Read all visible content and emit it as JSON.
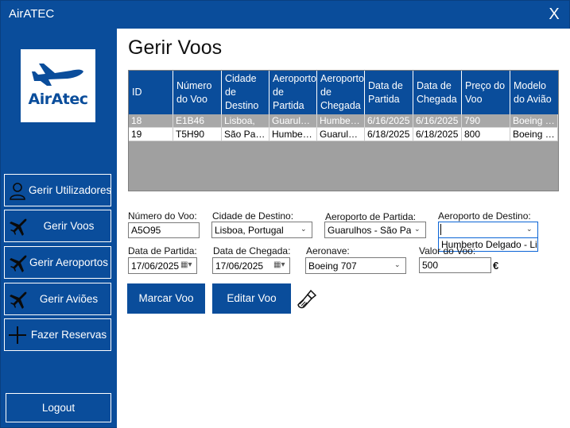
{
  "app": {
    "title": "AirATEC",
    "close_glyph": "X",
    "logo_text": "AirAtec"
  },
  "sidebar": {
    "items": [
      {
        "label": "Gerir Utilizadores",
        "icon": "user-icon"
      },
      {
        "label": "Gerir Voos",
        "icon": "airplane-icon"
      },
      {
        "label": "Gerir Aeroportos",
        "icon": "airplane-icon"
      },
      {
        "label": "Gerir Aviões",
        "icon": "airplane-icon"
      },
      {
        "label": "Fazer Reservas",
        "icon": "plus-icon"
      }
    ],
    "logout_label": "Logout"
  },
  "main": {
    "title": "Gerir Voos",
    "table": {
      "headers": [
        "ID",
        "Número do Voo",
        "Cidade de Destino",
        "Aeroporto de Partida",
        "Aeroporto de Chegada",
        "Data de Partida",
        "Data de Chegada",
        "Preço do Voo",
        "Modelo do Avião"
      ],
      "rows": [
        [
          "18",
          "E1B46",
          "Lisboa,",
          "Guarulhos",
          "Humbert...",
          "6/16/2025",
          "6/16/2025",
          "790",
          "Boeing 7..."
        ],
        [
          "19",
          "T5H90",
          "São Paul...",
          "Humbert...",
          "Guarulhos",
          "6/18/2025",
          "6/18/2025",
          "800",
          "Boeing 7..."
        ]
      ]
    },
    "form": {
      "numero_voo": {
        "label": "Número do Voo:",
        "value": "A5O95"
      },
      "cidade_destino": {
        "label": "Cidade de Destino:",
        "value": "Lisboa, Portugal"
      },
      "aeroporto_partida": {
        "label": "Aeroporto de Partida:",
        "value": "Guarulhos - São Paulo"
      },
      "aeroporto_destino": {
        "label": "Aeroporto de Destino:",
        "value": "",
        "dropdown_option": "Humberto Delgado - Lisboa"
      },
      "data_partida": {
        "label": "Data de Partida:",
        "value": "17/06/2025"
      },
      "data_chegada": {
        "label": "Data de Chegada:",
        "value": "17/06/2025"
      },
      "aeronave": {
        "label": "Aeronave:",
        "value": "Boeing 707"
      },
      "valor_voo": {
        "label": "Valor do Voo:",
        "value": "500",
        "currency": "€"
      }
    },
    "buttons": {
      "marcar": "Marcar Voo",
      "editar": "Editar Voo"
    }
  },
  "colors": {
    "primary": "#0a4d9b",
    "grid_bg": "#a0a0a0",
    "selected_row": "#a8a8a8"
  }
}
